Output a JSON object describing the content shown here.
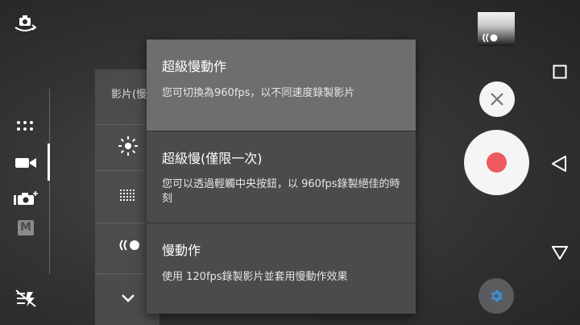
{
  "left_rail": {
    "mode_m_label": "M"
  },
  "sub_panel": {
    "header": "影片(慢"
  },
  "menu": {
    "items": [
      {
        "title": "超級慢動作",
        "desc": "您可切換為960fps，以不同速度錄製影片",
        "selected": true
      },
      {
        "title": "超級慢(僅限一次)",
        "desc": "您可以透過輕觸中央按鈕，以 960fps錄製絕佳的時刻",
        "selected": false
      },
      {
        "title": "慢動作",
        "desc": "使用 120fps錄製影片並套用慢動作效果",
        "selected": false
      }
    ]
  },
  "colors": {
    "record_dot": "#ee5a5e",
    "settings_icon": "#3a8fd8",
    "menu_bg": "#4b4b4b",
    "menu_selected_bg": "#6e6e6e"
  },
  "icons": {
    "switch_camera": "switch-camera-icon",
    "grid": "grid-dots-icon",
    "video": "video-camera-icon",
    "photo_plus": "photo-camera-plus-icon",
    "manual": "manual-mode-icon",
    "flash_off": "flash-off-icon",
    "brightness": "brightness-icon",
    "pattern": "pattern-grid-icon",
    "slowmo": "slow-motion-icon",
    "chevron_down": "chevron-down-icon",
    "close": "close-icon",
    "record": "record-icon",
    "settings": "gear-icon",
    "nav_square": "recents-square-icon",
    "nav_back": "back-triangle-icon",
    "nav_home": "home-triangle-icon"
  }
}
